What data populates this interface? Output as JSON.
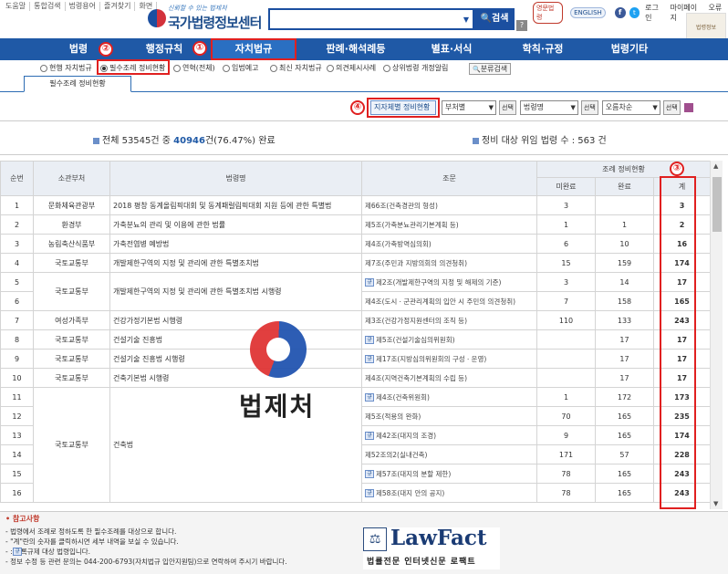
{
  "top_links": [
    "도움말",
    "통합검색",
    "법령용어",
    "즐겨찾기",
    "화면"
  ],
  "logo": {
    "tagline": "신뢰할 수 있는 법제처",
    "name": "국가법령정보센터"
  },
  "search": {
    "button_label": "검색",
    "help": "?"
  },
  "top_right": {
    "badge": "영문법령",
    "english": "ENGLISH",
    "facebook": "f",
    "twitter": "t",
    "login": "로그인",
    "mypage": "마이페이지",
    "error_report": "오류원",
    "side_label": "법령정보"
  },
  "nav": [
    "법령",
    "행정규칙",
    "자치법규",
    "판례·해석례등",
    "별표·서식",
    "학칙·규정",
    "법령기타"
  ],
  "subnav": [
    "현행 자치법규",
    "필수조례 정비현황",
    "연혁(전체)",
    "입법예고",
    "최신 자치법규",
    "의견제시사례",
    "상위법령 개정알림"
  ],
  "subnav_extra": "분류검색",
  "tab": "필수조례 정비현황",
  "toolbar": {
    "status_button": "지자체별 정비현황",
    "select1": "부처별",
    "btn1": "선택",
    "select2": "법령명",
    "btn2": "선택",
    "select3": "오름차순",
    "btn3": "선택"
  },
  "summary": {
    "left_prefix": "전체 53545건 중 ",
    "left_highlight": "40946",
    "left_suffix": "건(76.47%) 완료",
    "right": "정비 대상 위임 법령 수 : 563 건"
  },
  "table": {
    "headers": {
      "no": "순번",
      "ministry": "소관부처",
      "law": "법령명",
      "article": "조문",
      "status": "조례 정비현황",
      "incomplete": "미완료",
      "complete": "완료",
      "total": "계"
    },
    "rows": [
      {
        "no": "1",
        "ministry": "문화체육관광부",
        "law": "2018 평창 동계올림픽대회 및 동계패럴림픽대회 지원 등에 관한 특별법",
        "article": "제66조(건축경관의 형성)",
        "reg": false,
        "incomplete": "3",
        "complete": "",
        "total": "3"
      },
      {
        "no": "2",
        "ministry": "환경부",
        "law": "가축분뇨의 관리 및 이용에 관한 법률",
        "article": "제5조(가축분뇨관리기본계획 등)",
        "reg": false,
        "incomplete": "1",
        "complete": "1",
        "total": "2"
      },
      {
        "no": "3",
        "ministry": "농림축산식품부",
        "law": "가축전염병 예방법",
        "article": "제4조(가축방역심의회)",
        "reg": false,
        "incomplete": "6",
        "complete": "10",
        "total": "16"
      },
      {
        "no": "4",
        "ministry": "국토교통부",
        "law": "개발제한구역의 지정 및 관리에 관한 특별조치법",
        "article": "제7조(주민과 지방의회의 의견청취)",
        "reg": false,
        "incomplete": "15",
        "complete": "159",
        "total": "174"
      },
      {
        "no": "5",
        "ministry": "국토교통부",
        "law": "개발제한구역의 지정 및 관리에 관한 특별조치법 시행령",
        "article": "제2조(개발제한구역의 지정 및 해제의 기준)",
        "reg": true,
        "incomplete": "3",
        "complete": "14",
        "total": "17"
      },
      {
        "no": "6",
        "ministry": "",
        "law": "",
        "article": "제4조(도시ㆍ군관리계획의 입안 시 주민의 의견청취)",
        "reg": false,
        "incomplete": "7",
        "complete": "158",
        "total": "165"
      },
      {
        "no": "7",
        "ministry": "여성가족부",
        "law": "건강가정기본법 시행령",
        "article": "제3조(건강가정지원센터의 조직 등)",
        "reg": false,
        "incomplete": "110",
        "complete": "133",
        "total": "243"
      },
      {
        "no": "8",
        "ministry": "국토교통부",
        "law": "건설기술 진흥법",
        "article": "제5조(건설기술심의위원회)",
        "reg": true,
        "incomplete": "",
        "complete": "17",
        "total": "17"
      },
      {
        "no": "9",
        "ministry": "국토교통부",
        "law": "건설기술 진흥법 시행령",
        "article": "제17조(지방심의위원회의 구성ㆍ운영)",
        "reg": true,
        "incomplete": "",
        "complete": "17",
        "total": "17"
      },
      {
        "no": "10",
        "ministry": "국토교통부",
        "law": "건축기본법 시행령",
        "article": "제4조(지역건축기본계획의 수립 등)",
        "reg": false,
        "incomplete": "",
        "complete": "17",
        "total": "17"
      },
      {
        "no": "11",
        "ministry": "국토교통부",
        "law": "건축법",
        "article": "제4조(건축위원회)",
        "reg": true,
        "incomplete": "1",
        "complete": "172",
        "total": "173"
      },
      {
        "no": "12",
        "ministry": "",
        "law": "",
        "article": "제5조(적용의 완화)",
        "reg": false,
        "incomplete": "70",
        "complete": "165",
        "total": "235"
      },
      {
        "no": "13",
        "ministry": "",
        "law": "",
        "article": "제42조(대지의 조경)",
        "reg": true,
        "incomplete": "9",
        "complete": "165",
        "total": "174"
      },
      {
        "no": "14",
        "ministry": "",
        "law": "",
        "article": "제52조의2(실내건축)",
        "reg": false,
        "incomplete": "171",
        "complete": "57",
        "total": "228"
      },
      {
        "no": "15",
        "ministry": "",
        "law": "",
        "article": "제57조(대지의 분할 제한)",
        "reg": true,
        "incomplete": "78",
        "complete": "165",
        "total": "243"
      },
      {
        "no": "16",
        "ministry": "",
        "law": "",
        "article": "제58조(대지 안의 공지)",
        "reg": true,
        "incomplete": "78",
        "complete": "165",
        "total": "243"
      }
    ]
  },
  "notes": {
    "title": "참고사항",
    "lines": [
      "- 법령에서 조례로 정하도록 한 필수조례를 대상으로 합니다.",
      "- \"계\"란의 숫자를 클릭하시면 세부 내역을 보실 수 있습니다.",
      "-    : 등록규제 대상 법령입니다.",
      "- 정보 수정 등 관련 문의는 044-200-6793(자치법규 입안지원팀)으로 연락하여 주시기 바랍니다."
    ]
  },
  "watermark": "법제처",
  "lawfact": {
    "name": "LawFact",
    "slogan": "법률전문 인터넷신문 로팩트"
  },
  "annotations": [
    "①",
    "②",
    "③",
    "④"
  ],
  "reg_icon": "규"
}
